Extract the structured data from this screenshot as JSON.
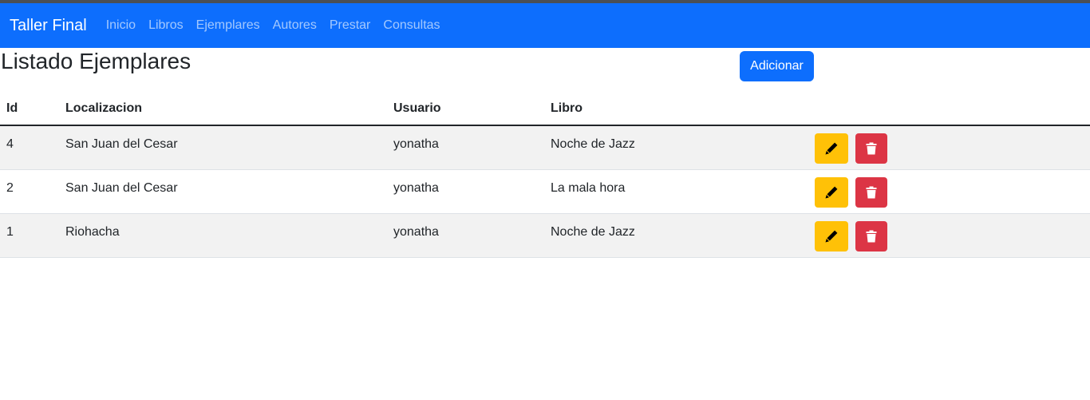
{
  "navbar": {
    "brand": "Taller Final",
    "links": [
      "Inicio",
      "Libros",
      "Ejemplares",
      "Autores",
      "Prestar",
      "Consultas"
    ]
  },
  "page": {
    "title": "Listado Ejemplares",
    "add_button": "Adicionar"
  },
  "table": {
    "headers": {
      "id": "Id",
      "localizacion": "Localizacion",
      "usuario": "Usuario",
      "libro": "Libro"
    },
    "rows": [
      {
        "id": "4",
        "localizacion": "San Juan del Cesar",
        "usuario": "yonatha",
        "libro": "Noche de Jazz"
      },
      {
        "id": "2",
        "localizacion": "San Juan del Cesar",
        "usuario": "yonatha",
        "libro": "La mala hora"
      },
      {
        "id": "1",
        "localizacion": "Riohacha",
        "usuario": "yonatha",
        "libro": "Noche de Jazz"
      }
    ]
  },
  "icons": {
    "edit": "pencil-icon",
    "delete": "trash-icon"
  },
  "colors": {
    "primary": "#0d6efd",
    "warning": "#ffc107",
    "danger": "#dc3545"
  }
}
